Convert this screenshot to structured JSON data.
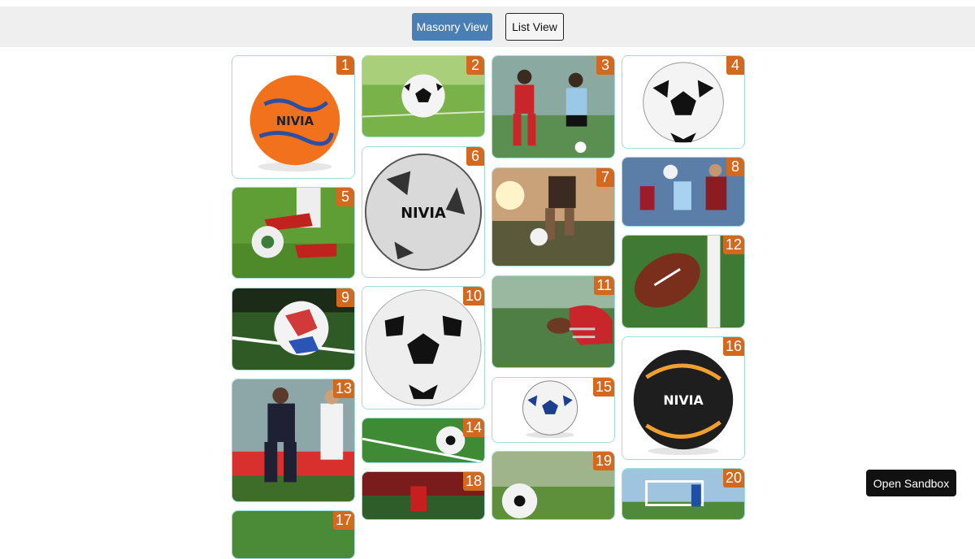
{
  "toolbar": {
    "masonry_label": "Masonry View",
    "list_label": "List View"
  },
  "gallery": {
    "items": [
      {
        "label": "1"
      },
      {
        "label": "2"
      },
      {
        "label": "3"
      },
      {
        "label": "4"
      },
      {
        "label": "5"
      },
      {
        "label": "6"
      },
      {
        "label": "7"
      },
      {
        "label": "8"
      },
      {
        "label": "9"
      },
      {
        "label": "10"
      },
      {
        "label": "11"
      },
      {
        "label": "12"
      },
      {
        "label": "13"
      },
      {
        "label": "14"
      },
      {
        "label": "15"
      },
      {
        "label": "16"
      },
      {
        "label": "17"
      },
      {
        "label": "18"
      },
      {
        "label": "19"
      },
      {
        "label": "20"
      }
    ]
  },
  "sandbox": {
    "label": "Open Sandbox"
  },
  "colors": {
    "accent": "#4a7fb5",
    "badge": "#d2691e",
    "tile_border": "#9fdcdc"
  }
}
